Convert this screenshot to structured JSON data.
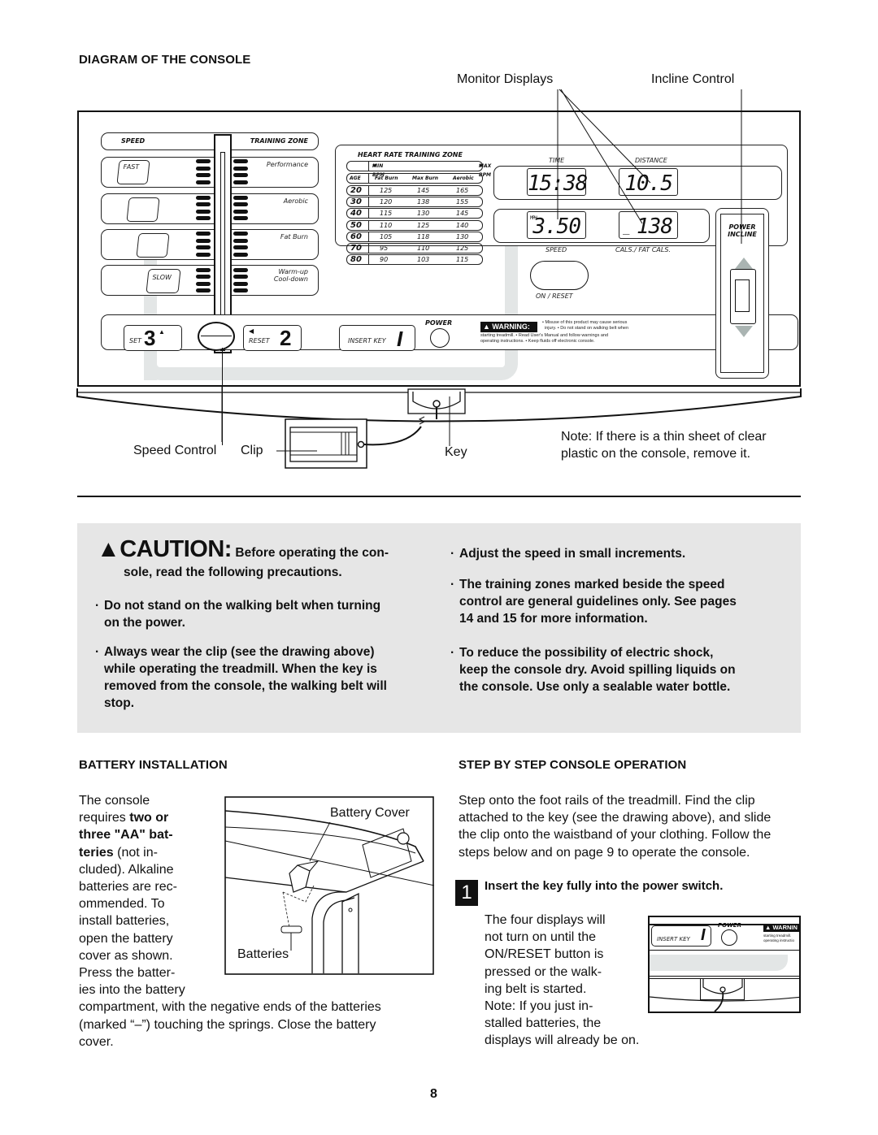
{
  "diagram": {
    "title": "DIAGRAM OF THE CONSOLE",
    "callouts": {
      "monitor_displays": "Monitor Displays",
      "incline_control": "Incline Control",
      "speed_control": "Speed Control",
      "clip": "Clip",
      "key": "Key"
    },
    "note_line1": "Note: If there is a thin sheet of clear",
    "note_line2": "plastic on the console, remove it."
  },
  "console": {
    "speed_label": "SPEED",
    "training_zone_label": "TRAINING ZONE",
    "speed_buttons": [
      "FAST",
      "",
      "",
      "SLOW"
    ],
    "zones": [
      "Performance",
      "Aerobic",
      "Fat Burn",
      "Warm-up",
      "Cool-down"
    ],
    "hr_table": {
      "title": "HEART RATE TRAINING ZONE",
      "min_bpm": "MIN BPM",
      "max_bpm": "MAX BPM",
      "headers": [
        "AGE",
        "Fat Burn",
        "Max Burn",
        "Aerobic"
      ],
      "rows": [
        [
          "20",
          "125",
          "145",
          "165"
        ],
        [
          "30",
          "120",
          "138",
          "155"
        ],
        [
          "40",
          "115",
          "130",
          "145"
        ],
        [
          "50",
          "110",
          "125",
          "140"
        ],
        [
          "60",
          "105",
          "118",
          "130"
        ],
        [
          "70",
          "95",
          "110",
          "125"
        ],
        [
          "80",
          "90",
          "103",
          "115"
        ]
      ]
    },
    "displays": {
      "time_label": "TIME",
      "time_value": "15:38",
      "distance_label": "DISTANCE",
      "distance_value": "10.5",
      "speed_unit": "MPH",
      "speed_value": "3.50",
      "speed_label": "SPEED",
      "cals_value": "138",
      "cals_label": "CALS./ FAT CALS."
    },
    "on_reset_label": "ON / RESET",
    "power_incline_line1": "POWER",
    "power_incline_line2": "INCLINE",
    "set_label": "SET",
    "set_number": "3",
    "reset_label": "RESET",
    "reset_number": "2",
    "insert_key_label": "INSERT KEY",
    "insert_key_number": "I",
    "power_label": "POWER",
    "warning_label": "WARNING:",
    "warning_text_1": "• Misuse of this product may cause serious",
    "warning_text_2": "injury.  • Do not stand on walking belt when",
    "warning_text_3": "starting treadmill.  • Read User's Manual and follow warnings and",
    "warning_text_4": "operating instructions.  • Keep fluids off electronic console."
  },
  "caution": {
    "title": "CAUTION:",
    "intro_1": "Before operating the con-",
    "intro_2": "sole, read the following precautions.",
    "left_bullets": [
      [
        "Do not stand on the walking belt when turning",
        "on the power."
      ],
      [
        "Always wear the clip (see the drawing above)",
        "while operating the treadmill. When the key is",
        "removed from the console, the walking belt will",
        "stop."
      ]
    ],
    "right_bullets": [
      [
        "Adjust the speed in small increments."
      ],
      [
        "The training zones marked beside the speed",
        "control are general guidelines only. See pages",
        "14 and 15 for more information."
      ],
      [
        "To reduce the possibility of electric shock,",
        "keep the console dry. Avoid spilling liquids on",
        "the console. Use only a sealable water bottle."
      ]
    ]
  },
  "battery": {
    "heading": "BATTERY INSTALLATION",
    "lines": [
      "The console",
      "requires ",
      "three \"AA\" bat-",
      "teries",
      " (not in-",
      "cluded). Alkaline",
      "batteries are rec-",
      "ommended. To",
      "install batteries,",
      "open the battery",
      "cover as shown.",
      "Press the batter-",
      "ies into the battery",
      "compartment, with the negative ends of the batteries",
      "(marked “–”) touching the springs. Close the battery",
      "cover."
    ],
    "bold_two_or": "two or",
    "figure_battery_cover": "Battery Cover",
    "figure_batteries": "Batteries"
  },
  "operation": {
    "heading": "STEP BY STEP CONSOLE OPERATION",
    "intro": [
      "Step onto the foot rails of the treadmill. Find the clip",
      "attached to the key (see the drawing above), and slide",
      "the clip onto the waistband of your clothing. Follow the",
      "steps below and on page 9 to operate the console."
    ],
    "step_number": "1",
    "step_title": "Insert the key fully into the power switch.",
    "step_text": [
      "The four displays will",
      "not turn on until the",
      "ON/RESET button is",
      "pressed or the walk-",
      "ing belt is started.",
      "Note: If you just in-",
      "stalled batteries, the",
      "displays will already be on."
    ],
    "mini_insert_key": "INSERT KEY",
    "mini_insert_number": "I",
    "mini_power": "POWER",
    "mini_warning": "WARNIN",
    "mini_warn_1": "starting treadmill.",
    "mini_warn_2": "operating instructio"
  },
  "page_number": "8"
}
